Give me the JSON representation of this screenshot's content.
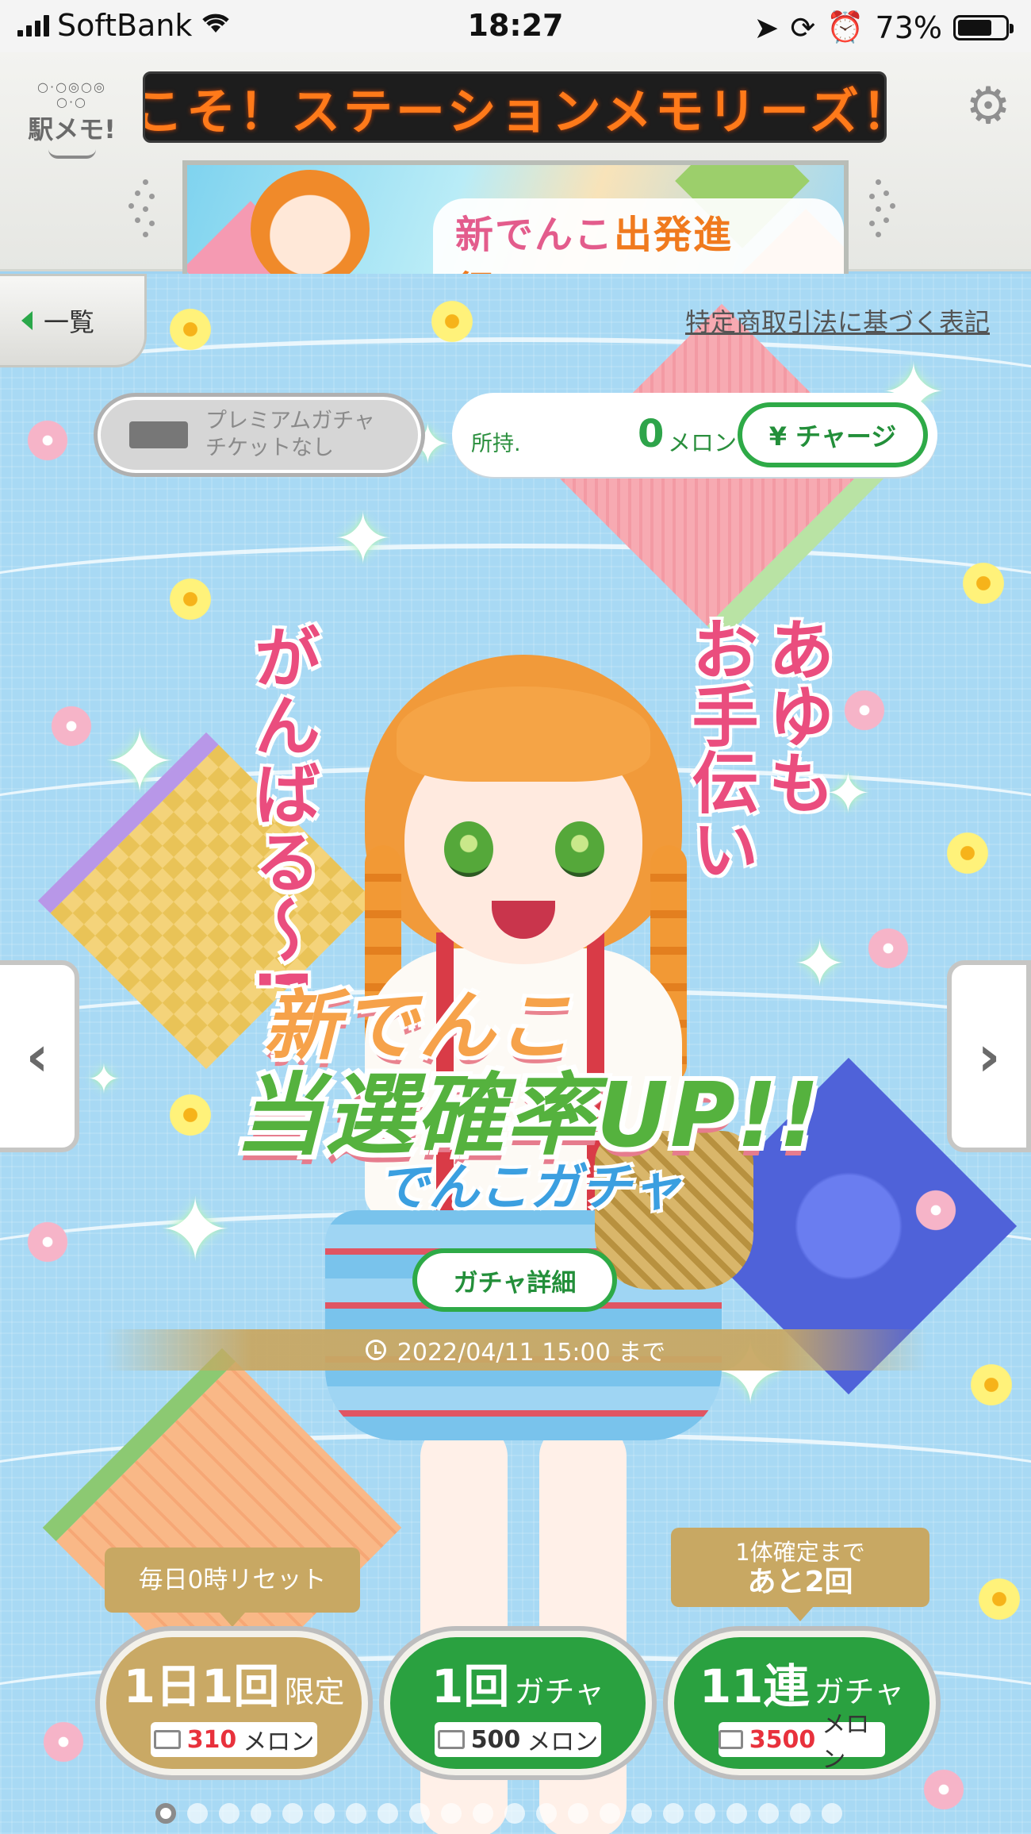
{
  "status_bar": {
    "carrier": "SoftBank",
    "time": "18:27",
    "battery": "73%",
    "battery_level": 0.73
  },
  "header": {
    "logo": "駅メモ!",
    "ticker": "こそ！ステーションメモリーズ！(",
    "banner_text_1": "新でんこ",
    "banner_text_2": "出発進行",
    "banner_text_3": "〜!"
  },
  "nav": {
    "back_label": "一覧",
    "legal_link": "特定商取引法に基づく表記"
  },
  "ticket": {
    "line1": "プレミアムガチャ",
    "line2": "チケットなし"
  },
  "wallet": {
    "own_label": "所持.",
    "amount": "0",
    "unit": "メロン",
    "charge_label": "¥ チャージ"
  },
  "speech": {
    "left": "がんばる〜!",
    "right": "あゆも\nお手伝い"
  },
  "title": {
    "line1": "新でんこ",
    "line2": "当選確率UP!!",
    "line3": "でんこガチャ"
  },
  "detail_label": "ガチャ詳細",
  "period": "2022/04/11 15:00 まで",
  "tags": {
    "daily": "毎日0時リセット",
    "guarantee_line1": "1体確定まで",
    "guarantee_line2": "あと2回"
  },
  "gacha_buttons": [
    {
      "count": "1日1回",
      "suffix": "限定",
      "price": "310",
      "unit": "メロン"
    },
    {
      "count": "1回",
      "suffix": "ガチャ",
      "price": "500",
      "unit": "メロン"
    },
    {
      "count": "11連",
      "suffix": "ガチャ",
      "price": "3500",
      "unit": "メロン"
    }
  ],
  "pager": {
    "total": 22,
    "active": 1
  },
  "colors": {
    "accent_green": "#2eaa47",
    "gold": "#c8a863",
    "sky": "#a8d9f4",
    "pink_text": "#ea4d7e"
  }
}
